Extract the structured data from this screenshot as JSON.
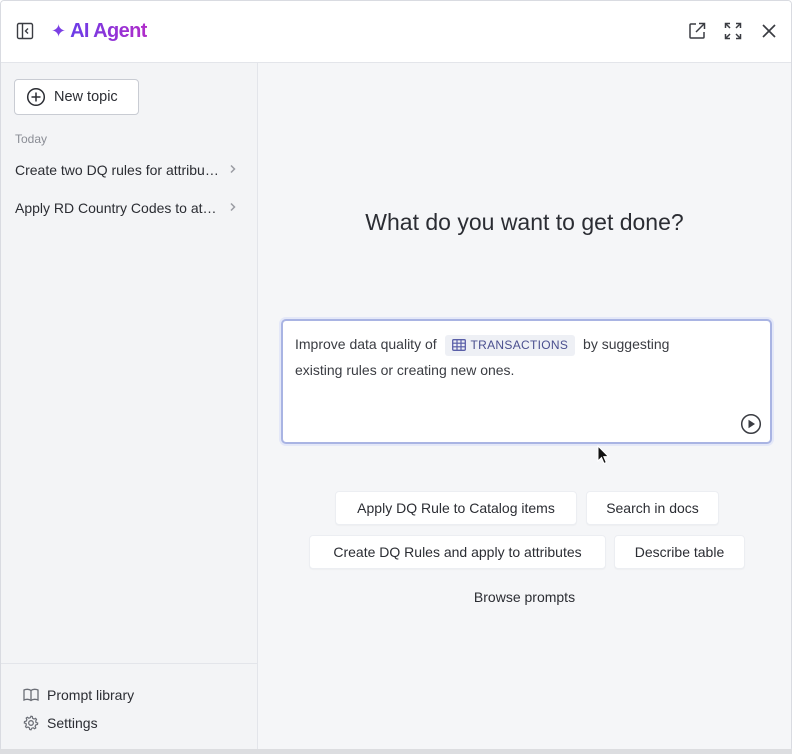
{
  "header": {
    "brand_star": "✦",
    "brand_name": "AI Agent",
    "icons": [
      "sidebar-toggle-icon",
      "external-link-icon",
      "expand-icon",
      "close-icon"
    ]
  },
  "sidebar": {
    "new_topic_label": "New topic",
    "section_label": "Today",
    "topics": [
      {
        "label": "Create two DQ rules for attributes"
      },
      {
        "label": "Apply RD Country Codes to attributes"
      }
    ],
    "footer": {
      "prompt_library_label": "Prompt library",
      "settings_label": "Settings"
    }
  },
  "main": {
    "headline": "What do you want to get done?",
    "prompt": {
      "before": "Improve data quality of",
      "chip_label": "TRANSACTIONS",
      "after": "by suggesting existing rules or creating new ones."
    },
    "suggestions": [
      "Apply DQ Rule to Catalog items",
      "Search in docs",
      "Create DQ Rules and apply to attributes",
      "Describe table"
    ],
    "browse_label": "Browse prompts"
  },
  "colors": {
    "brand_gradient_start": "#6a3de8",
    "brand_gradient_end": "#b02cc9",
    "prompt_border": "#a9b4e3",
    "chip_text": "#4a4f8f"
  }
}
